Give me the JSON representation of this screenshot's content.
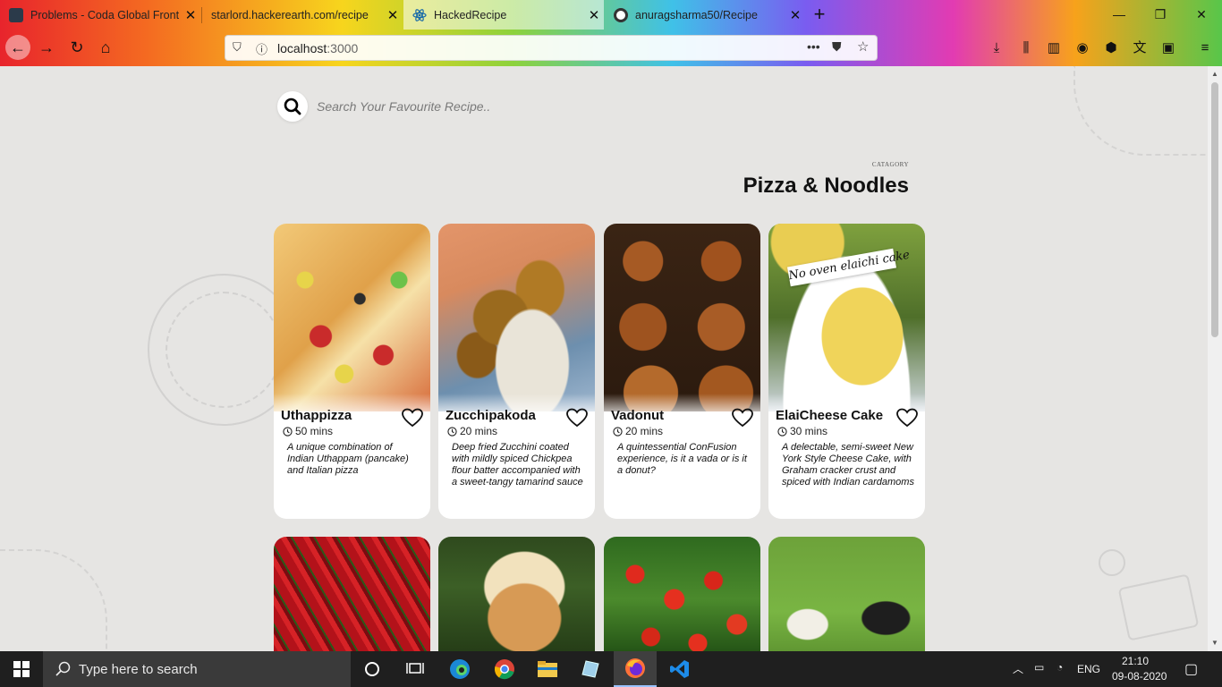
{
  "browser": {
    "tabs": [
      {
        "title": "Problems - Coda Global Front",
        "active": false
      },
      {
        "title": "starlord.hackerearth.com/recipe",
        "active": false
      },
      {
        "title": "HackedRecipe",
        "active": true
      },
      {
        "title": "anuragsharma50/Recipe",
        "active": false
      }
    ],
    "url_host": "localhost",
    "url_port": ":3000"
  },
  "search": {
    "placeholder": "Search Your Favourite Recipe.."
  },
  "category": {
    "label": "CATAGORY",
    "title": "Pizza & Noodles"
  },
  "recipes": [
    {
      "name": "Uthappizza",
      "time": "50 mins",
      "description": "A unique combination of Indian Uthappam (pancake) and Italian pizza"
    },
    {
      "name": "Zucchipakoda",
      "time": "20 mins",
      "description": "Deep fried Zucchini coated with mildly spiced Chickpea flour batter accompanied with a sweet-tangy tamarind sauce"
    },
    {
      "name": "Vadonut",
      "time": "20 mins",
      "description": "A quintessential ConFusion experience, is it a vada or is it a donut?"
    },
    {
      "name": "ElaiCheese Cake",
      "time": "30 mins",
      "description": "A delectable, semi-sweet New York Style Cheese Cake, with Graham cracker crust and spiced with Indian cardamoms",
      "image_caption": "No oven elaichi cake"
    }
  ],
  "taskbar": {
    "search_placeholder": "Type here to search",
    "language": "ENG",
    "time": "21:10",
    "date": "09-08-2020"
  },
  "colors": {
    "page_bg": "#e6e5e3",
    "card_bg": "#ffffff",
    "taskbar_bg": "#1f1f1f"
  }
}
